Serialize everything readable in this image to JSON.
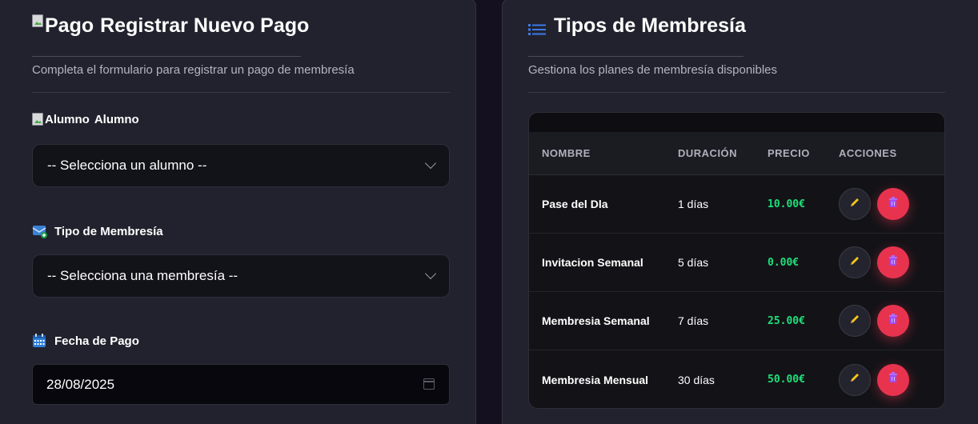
{
  "left": {
    "title_img_alt": "Pago",
    "title": "Registrar Nuevo Pago",
    "subtitle": "Completa el formulario para registrar un pago de membresía",
    "fields": {
      "alumno": {
        "img_alt": "Alumno",
        "label": "Alumno",
        "value": "-- Selecciona un alumno --"
      },
      "membresia": {
        "label": "Tipo de Membresía",
        "value": "-- Selecciona una membresía --"
      },
      "fecha": {
        "label": "Fecha de Pago",
        "value": "28/08/2025"
      }
    }
  },
  "right": {
    "title": "Tipos de Membresía",
    "subtitle": "Gestiona los planes de membresía disponibles",
    "table": {
      "headers": {
        "name": "NOMBRE",
        "duration": "DURACIÓN",
        "price": "PRECIO",
        "actions": "ACCIONES"
      },
      "rows": [
        {
          "name": "Pase del Dla",
          "duration": "1 días",
          "price": "10.00€"
        },
        {
          "name": "Invitacion Semanal",
          "duration": "5 días",
          "price": "0.00€"
        },
        {
          "name": "Membresia Semanal",
          "duration": "7 días",
          "price": "25.00€"
        },
        {
          "name": "Membresia Mensual",
          "duration": "30 días",
          "price": "50.00€"
        }
      ]
    }
  },
  "colors": {
    "price_green": "#1ee07a",
    "delete_red": "#e8334f",
    "edit_pencil": "#f5c518",
    "list_icon_blue": "#3b7be8"
  },
  "icons": {
    "edit": "pencil-icon",
    "delete": "trash-icon",
    "list": "list-icon",
    "membership": "card-icon",
    "date": "calendar-icon"
  }
}
